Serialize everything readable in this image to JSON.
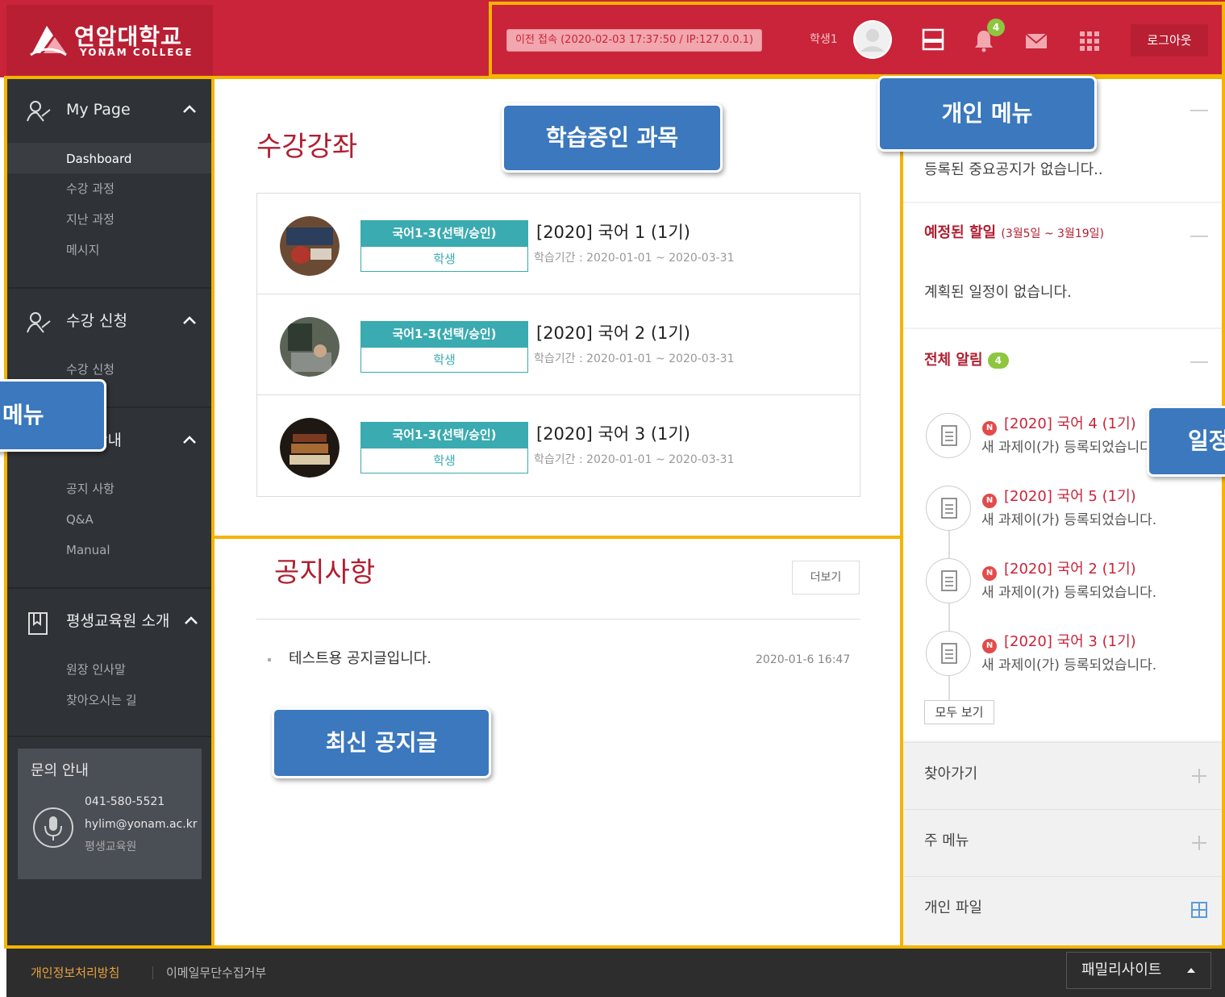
{
  "header": {
    "logo_kr": "연암대학교",
    "logo_en": "YONAM COLLEGE",
    "last_login": "이전 접속 (2020-02-03 17:37:50 / IP:127.0.0.1)",
    "user_name": "학생1",
    "notification_count": "4",
    "logout_label": "로그아웃",
    "icons": [
      "layout-icon",
      "bell-icon",
      "mail-icon",
      "grid-icon"
    ]
  },
  "sidebar": {
    "sections": [
      {
        "label": "My Page",
        "icon": "user-icon",
        "items": [
          "Dashboard",
          "수강 과정",
          "지난 과정",
          "메시지"
        ]
      },
      {
        "label": "수강 신청",
        "icon": "user-icon",
        "items": [
          "수강 신청"
        ]
      },
      {
        "label": "안내",
        "icon": "info-icon",
        "items": [
          "공지 사항",
          "Q&A",
          "Manual"
        ]
      },
      {
        "label": "평생교육원 소개",
        "icon": "book-icon",
        "items": [
          "원장 인사말",
          "찾아오시는 길"
        ]
      }
    ],
    "contact": {
      "title": "문의 안내",
      "phone": "041-580-5521",
      "email": "hylim@yonam.ac.kr",
      "org": "평생교육원"
    }
  },
  "courses": {
    "title": "수강강좌",
    "items": [
      {
        "category": "국어1-3(선택/승인)",
        "role": "학생",
        "name": "[2020] 국어 1 (1기)",
        "period": "학습기간 : 2020-01-01 ~ 2020-03-31"
      },
      {
        "category": "국어1-3(선택/승인)",
        "role": "학생",
        "name": "[2020] 국어 2 (1기)",
        "period": "학습기간 : 2020-01-01 ~ 2020-03-31"
      },
      {
        "category": "국어1-3(선택/승인)",
        "role": "학생",
        "name": "[2020] 국어 3 (1기)",
        "period": "학습기간 : 2020-01-01 ~ 2020-03-31"
      }
    ]
  },
  "notices": {
    "title": "공지사항",
    "more_label": "더보기",
    "items": [
      {
        "text": "테스트용 공지글입니다.",
        "date": "2020-01-6 16:47"
      }
    ]
  },
  "right": {
    "important_notice_empty": "등록된 중요공지가 없습니다..",
    "upcoming": {
      "title": "예정된 할일",
      "range": "(3월5일 ~ 3월19일)",
      "empty": "계획된 일정이 없습니다."
    },
    "alerts": {
      "title": "전체 알림",
      "count": "4",
      "items": [
        {
          "title": "[2020] 국어 4 (1기)",
          "sub": "새 과제이(가) 등록되었습니다."
        },
        {
          "title": "[2020] 국어 5 (1기)",
          "sub": "새 과제이(가) 등록되었습니다."
        },
        {
          "title": "[2020] 국어 2 (1기)",
          "sub": "새 과제이(가) 등록되었습니다."
        },
        {
          "title": "[2020] 국어 3 (1기)",
          "sub": "새 과제이(가) 등록되었습니다."
        }
      ],
      "all_label": "모두 보기"
    },
    "blocks": [
      {
        "label": "찾아가기",
        "icon": "plus-icon"
      },
      {
        "label": "주 메뉴",
        "icon": "plus-icon"
      },
      {
        "label": "개인 파일",
        "icon": "grid-icon"
      }
    ]
  },
  "footer": {
    "privacy": "개인정보처리방침",
    "email_policy": "이메일무단수집거부",
    "family_site": "패밀리사이트"
  },
  "annotations": {
    "courses_callout": "학습중인 과목",
    "personal_menu_callout": "개인 메뉴",
    "menu_callout": "메뉴",
    "schedule_callout": "일정",
    "notice_callout": "최신 공지글"
  },
  "colors": {
    "brand": "#c9243a",
    "accent": "#3aabb0",
    "annotation_border": "#f5b400",
    "callout": "#3b78bd"
  }
}
